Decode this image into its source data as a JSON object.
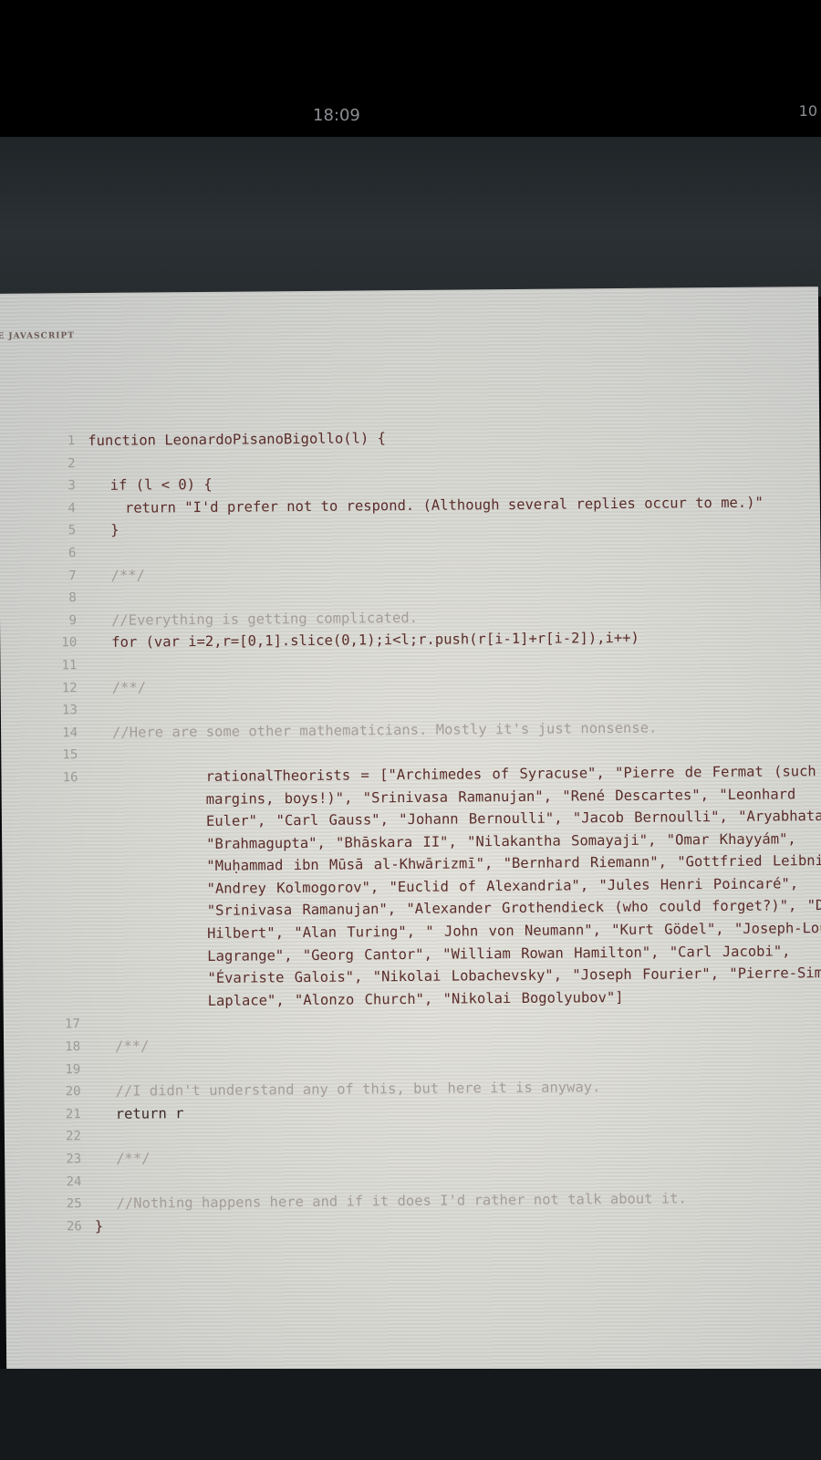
{
  "status_bar": {
    "time": "18:09",
    "right_text": "10"
  },
  "page": {
    "running_head": "E JAVASCRIPT"
  },
  "code": {
    "lines": [
      {
        "n": "1",
        "text": "function LeonardoPisanoBigollo(l) {",
        "indent": 0,
        "kind": "code"
      },
      {
        "n": "2",
        "text": "",
        "indent": 0,
        "kind": "code"
      },
      {
        "n": "3",
        "text": "if (l < 0) {",
        "indent": 1,
        "kind": "code"
      },
      {
        "n": "4",
        "text": "return \"I'd prefer not to respond. (Although several replies occur to me.)\"",
        "indent": 2,
        "kind": "code"
      },
      {
        "n": "5",
        "text": "}",
        "indent": 1,
        "kind": "code"
      },
      {
        "n": "6",
        "text": "",
        "indent": 0,
        "kind": "code"
      },
      {
        "n": "7",
        "text": "/**/",
        "indent": 1,
        "kind": "comment"
      },
      {
        "n": "8",
        "text": "",
        "indent": 0,
        "kind": "code"
      },
      {
        "n": "9",
        "text": "//Everything is getting complicated.",
        "indent": 1,
        "kind": "comment"
      },
      {
        "n": "10",
        "text": "for (var i=2,r=[0,1].slice(0,1);i<l;r.push(r[i-1]+r[i-2]),i++)",
        "indent": 1,
        "kind": "code"
      },
      {
        "n": "11",
        "text": "",
        "indent": 0,
        "kind": "code"
      },
      {
        "n": "12",
        "text": "/**/",
        "indent": 1,
        "kind": "comment"
      },
      {
        "n": "13",
        "text": "",
        "indent": 0,
        "kind": "code"
      },
      {
        "n": "14",
        "text": "//Here are some other mathematicians. Mostly it's just nonsense.",
        "indent": 1,
        "kind": "comment"
      },
      {
        "n": "15",
        "text": "",
        "indent": 0,
        "kind": "code"
      },
      {
        "n": "16",
        "text": "rationalTheorists = [\"Archimedes of Syracuse\", \"Pierre de Fermat (such margins, boys!)\", \"Srinivasa Ramanujan\", \"René Descartes\", \"Leonhard Euler\", \"Carl Gauss\", \"Johann Bernoulli\", \"Jacob Bernoulli\", \"Aryabhata\", \"Brahmagupta\", \"Bhāskara II\", \"Nilakantha Somayaji\", \"Omar Khayyám\", \"Muḥammad ibn Mūsā al-Khwārizmī\", \"Bernhard Riemann\", \"Gottfried Leibniz\", \"Andrey Kolmogorov\", \"Euclid of Alexandria\", \"Jules Henri Poincaré\", \"Srinivasa Ramanujan\", \"Alexander Grothendieck (who could forget?)\", \"David Hilbert\", \"Alan Turing\", \" John von Neumann\", \"Kurt Gödel\", \"Joseph-Louis Lagrange\", \"Georg Cantor\", \"William Rowan Hamilton\", \"Carl Jacobi\", \"Évariste Galois\", \"Nikolai Lobachevsky\", \"Joseph Fourier\", \"Pierre-Simon Laplace\", \"Alonzo Church\", \"Nikolai Bogolyubov\"]",
        "indent": 1,
        "kind": "wrap"
      },
      {
        "n": "17",
        "text": "",
        "indent": 0,
        "kind": "code"
      },
      {
        "n": "18",
        "text": "/**/",
        "indent": 1,
        "kind": "comment"
      },
      {
        "n": "19",
        "text": "",
        "indent": 0,
        "kind": "code"
      },
      {
        "n": "20",
        "text": "//I didn't understand any of this, but here it is anyway.",
        "indent": 1,
        "kind": "comment"
      },
      {
        "n": "21",
        "text": "return r",
        "indent": 1,
        "kind": "keyword"
      },
      {
        "n": "22",
        "text": "",
        "indent": 0,
        "kind": "code"
      },
      {
        "n": "23",
        "text": "/**/",
        "indent": 1,
        "kind": "comment"
      },
      {
        "n": "24",
        "text": "",
        "indent": 0,
        "kind": "code"
      },
      {
        "n": "25",
        "text": "//Nothing happens here and if it does I'd rather not talk about it.",
        "indent": 1,
        "kind": "comment"
      },
      {
        "n": "26",
        "text": "}",
        "indent": 0,
        "kind": "code"
      }
    ]
  }
}
